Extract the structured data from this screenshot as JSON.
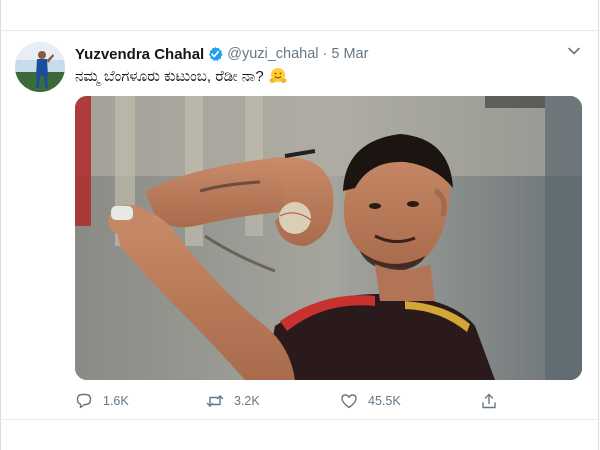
{
  "tweet": {
    "author_name": "Yuzvendra Chahal",
    "handle": "@yuzi_chahal",
    "separator": "·",
    "date": "5 Mar",
    "text": "ನಮ್ಮ ಬೆಂಗಳೂರು ಕುಟುಂಬ, ರೆಡೀ ನಾ?",
    "emoji": "hugging-face"
  },
  "actions": {
    "replies": "1.6K",
    "retweets": "3.2K",
    "likes": "45.5K"
  },
  "colors": {
    "name": "#14171a",
    "secondary": "#657786",
    "verified": "#1da1f2",
    "divider": "#e6ecf0"
  }
}
